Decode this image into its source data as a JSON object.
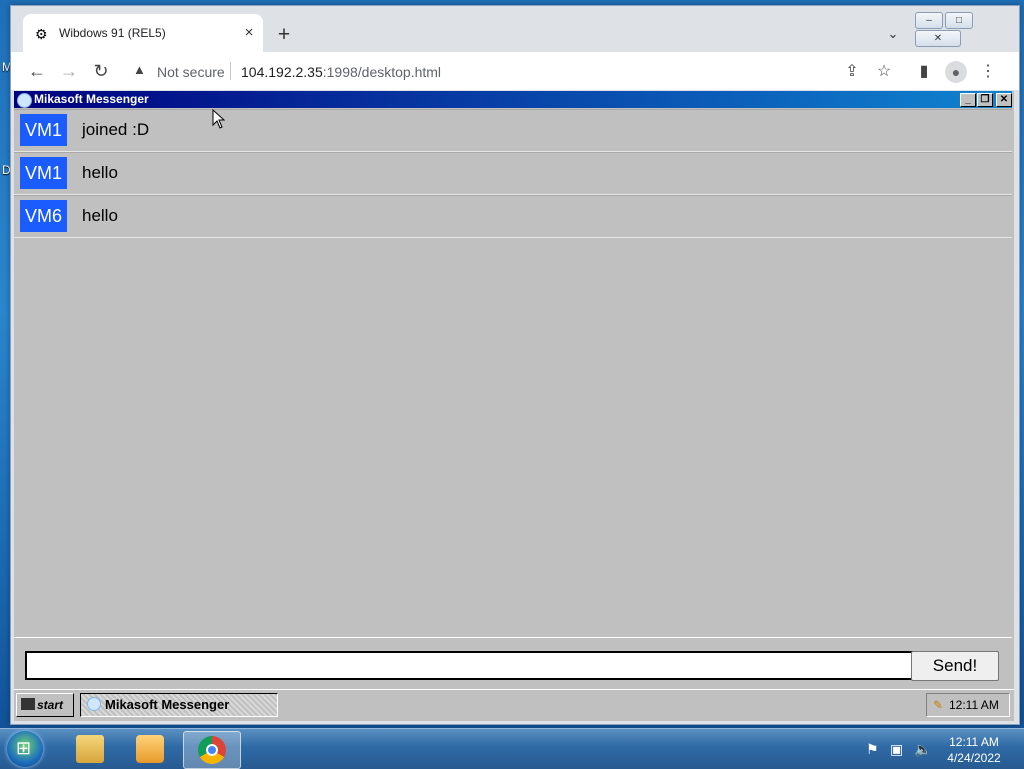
{
  "desktop": {
    "labels": [
      "M",
      "D"
    ]
  },
  "browser": {
    "tab_title": "Wibdows 91 (REL5)",
    "tab_close": "×",
    "new_tab": "+",
    "tab_search": "⌄",
    "window_buttons": {
      "minimize": "–",
      "maximize": "□",
      "close": "✕"
    },
    "nav": {
      "back": "←",
      "forward": "→",
      "reload": "↻"
    },
    "security_label": "Not secure",
    "url_host": "104.192.2.35",
    "url_rest": ":1998/desktop.html",
    "icons": [
      "share-icon",
      "star-icon",
      "sidepanel-icon",
      "profile-icon",
      "menu-icon"
    ]
  },
  "messenger": {
    "title": "Mikasoft Messenger",
    "title_buttons": {
      "minimize": "_",
      "restore": "❐",
      "close": "✕"
    },
    "messages": [
      {
        "sender": "VM1",
        "text": "joined :D"
      },
      {
        "sender": "VM1",
        "text": "hello"
      },
      {
        "sender": "VM6",
        "text": "hello"
      }
    ],
    "input_value": "",
    "send_label": "Send!"
  },
  "taskbar98": {
    "start_label": "start",
    "task_item": "Mikasoft Messenger",
    "clock": "12:11 AM"
  },
  "taskbar7": {
    "time": "12:11 AM",
    "date": "4/24/2022",
    "pinned": [
      "explorer-icon",
      "media-player-icon",
      "chrome-icon"
    ]
  }
}
